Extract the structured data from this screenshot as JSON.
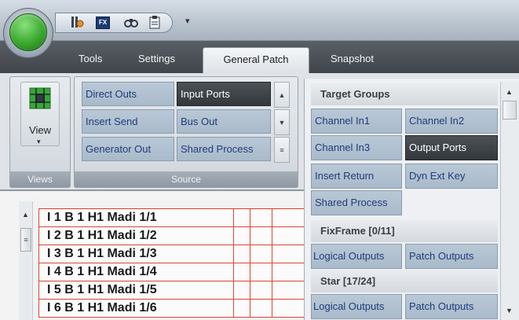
{
  "quick_access": {
    "icons": [
      "routing-tool-icon",
      "fx-icon",
      "binoculars-icon",
      "clipboard-icon"
    ],
    "fx_label": "FX",
    "dropdown_glyph": "▾"
  },
  "tabs": [
    {
      "label": "Tools"
    },
    {
      "label": "Settings"
    },
    {
      "label": "General Patch",
      "active": true
    },
    {
      "label": "Snapshot"
    }
  ],
  "views_group": {
    "button_label": "View",
    "group_label": "Views"
  },
  "source_group": {
    "group_label": "Source",
    "buttons": [
      {
        "label": "Direct Outs",
        "selected": false
      },
      {
        "label": "Input Ports",
        "selected": true
      },
      {
        "label": "Insert Send",
        "selected": false
      },
      {
        "label": "Bus Out",
        "selected": false
      },
      {
        "label": "Generator Out",
        "selected": false
      },
      {
        "label": "Shared Process",
        "selected": false
      }
    ]
  },
  "target_groups": {
    "header": "Target Groups",
    "buttons": [
      {
        "label": "Channel In1",
        "selected": false
      },
      {
        "label": "Channel In2",
        "selected": false
      },
      {
        "label": "Channel In3",
        "selected": false
      },
      {
        "label": "Output Ports",
        "selected": true
      },
      {
        "label": "Insert Return",
        "selected": false
      },
      {
        "label": "Dyn Ext Key",
        "selected": false
      },
      {
        "label": "Shared Process",
        "selected": false
      }
    ],
    "sections": [
      {
        "title": "FixFrame [0/11]",
        "buttons": [
          "Logical Outputs",
          "Patch Outputs"
        ]
      },
      {
        "title": "Star [17/24]",
        "buttons": [
          "Logical Outputs",
          "Patch Outputs"
        ]
      }
    ]
  },
  "grid": {
    "rows": [
      "I  1 B 1 H1 Madi 1/1",
      "I  2 B 1 H1 Madi 1/2",
      "I  3 B 1 H1 Madi 1/3",
      "I  4 B 1 H1 Madi 1/4",
      "I  5 B 1 H1 Madi 1/5",
      "I  6 B 1 H1 Madi 1/6"
    ]
  },
  "colors": {
    "accent_selected": "#3a3f44",
    "button_fill": "#b4c3d2",
    "button_text": "#1f3c7a",
    "grid_line": "#d6463a",
    "orb": "#3aa82f"
  }
}
